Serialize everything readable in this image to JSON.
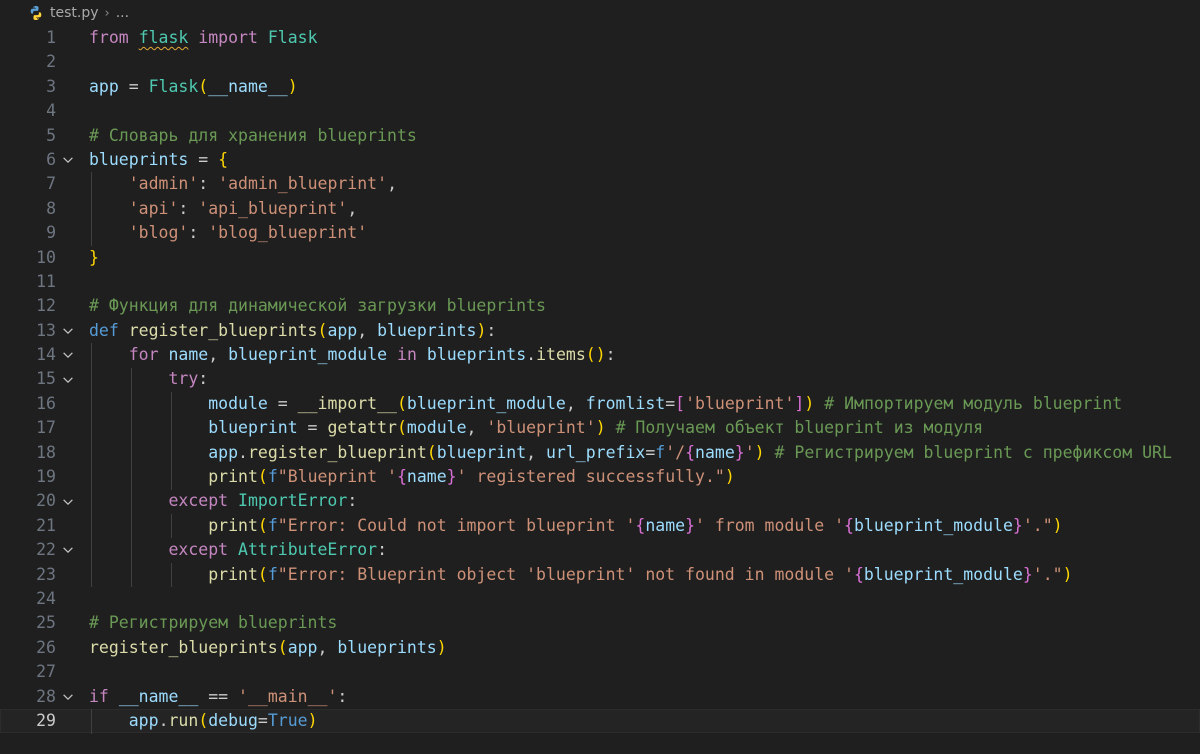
{
  "breadcrumb": {
    "file": "test.py",
    "ellipsis": "..."
  },
  "current_line": 29,
  "lines": [
    {
      "n": "1",
      "fold": false,
      "tokens": [
        {
          "t": "from",
          "c": "ck"
        },
        {
          "t": " "
        },
        {
          "t": "flask",
          "c": "cls squig"
        },
        {
          "t": " "
        },
        {
          "t": "import",
          "c": "ck"
        },
        {
          "t": " "
        },
        {
          "t": "Flask",
          "c": "cls"
        }
      ]
    },
    {
      "n": "2",
      "fold": false,
      "tokens": []
    },
    {
      "n": "3",
      "fold": false,
      "tokens": [
        {
          "t": "app",
          "c": "var"
        },
        {
          "t": " = "
        },
        {
          "t": "Flask",
          "c": "cls"
        },
        {
          "t": "(",
          "c": "b1"
        },
        {
          "t": "__name__",
          "c": "var"
        },
        {
          "t": ")",
          "c": "b1"
        }
      ]
    },
    {
      "n": "4",
      "fold": false,
      "tokens": []
    },
    {
      "n": "5",
      "fold": false,
      "tokens": [
        {
          "t": "# Словарь для хранения blueprints",
          "c": "com"
        }
      ]
    },
    {
      "n": "6",
      "fold": true,
      "tokens": [
        {
          "t": "blueprints",
          "c": "var"
        },
        {
          "t": " = "
        },
        {
          "t": "{",
          "c": "b1"
        }
      ]
    },
    {
      "n": "7",
      "fold": false,
      "tokens": [
        {
          "t": "    "
        },
        {
          "t": "'admin'",
          "c": "str"
        },
        {
          "t": ": "
        },
        {
          "t": "'admin_blueprint'",
          "c": "str"
        },
        {
          "t": ","
        }
      ]
    },
    {
      "n": "8",
      "fold": false,
      "tokens": [
        {
          "t": "    "
        },
        {
          "t": "'api'",
          "c": "str"
        },
        {
          "t": ": "
        },
        {
          "t": "'api_blueprint'",
          "c": "str"
        },
        {
          "t": ","
        }
      ]
    },
    {
      "n": "9",
      "fold": false,
      "tokens": [
        {
          "t": "    "
        },
        {
          "t": "'blog'",
          "c": "str"
        },
        {
          "t": ": "
        },
        {
          "t": "'blog_blueprint'",
          "c": "str"
        }
      ]
    },
    {
      "n": "10",
      "fold": false,
      "tokens": [
        {
          "t": "}",
          "c": "b1"
        }
      ]
    },
    {
      "n": "11",
      "fold": false,
      "tokens": []
    },
    {
      "n": "12",
      "fold": false,
      "tokens": [
        {
          "t": "# Функция для динамической загрузки blueprints",
          "c": "com"
        }
      ]
    },
    {
      "n": "13",
      "fold": true,
      "tokens": [
        {
          "t": "def",
          "c": "kw"
        },
        {
          "t": " "
        },
        {
          "t": "register_blueprints",
          "c": "fn"
        },
        {
          "t": "(",
          "c": "b1"
        },
        {
          "t": "app",
          "c": "var"
        },
        {
          "t": ", "
        },
        {
          "t": "blueprints",
          "c": "var"
        },
        {
          "t": ")",
          "c": "b1"
        },
        {
          "t": ":"
        }
      ]
    },
    {
      "n": "14",
      "fold": true,
      "tokens": [
        {
          "t": "    "
        },
        {
          "t": "for",
          "c": "ck"
        },
        {
          "t": " "
        },
        {
          "t": "name",
          "c": "var"
        },
        {
          "t": ", "
        },
        {
          "t": "blueprint_module",
          "c": "var"
        },
        {
          "t": " "
        },
        {
          "t": "in",
          "c": "ck"
        },
        {
          "t": " "
        },
        {
          "t": "blueprints",
          "c": "var"
        },
        {
          "t": "."
        },
        {
          "t": "items",
          "c": "fn"
        },
        {
          "t": "()",
          "c": "b1"
        },
        {
          "t": ":"
        }
      ]
    },
    {
      "n": "15",
      "fold": true,
      "tokens": [
        {
          "t": "        "
        },
        {
          "t": "try",
          "c": "ck"
        },
        {
          "t": ":"
        }
      ]
    },
    {
      "n": "16",
      "fold": false,
      "tokens": [
        {
          "t": "            "
        },
        {
          "t": "module",
          "c": "var"
        },
        {
          "t": " = "
        },
        {
          "t": "__import__",
          "c": "fn"
        },
        {
          "t": "(",
          "c": "b1"
        },
        {
          "t": "blueprint_module",
          "c": "var"
        },
        {
          "t": ", "
        },
        {
          "t": "fromlist",
          "c": "var"
        },
        {
          "t": "="
        },
        {
          "t": "[",
          "c": "b2"
        },
        {
          "t": "'blueprint'",
          "c": "str"
        },
        {
          "t": "]",
          "c": "b2"
        },
        {
          "t": ")",
          "c": "b1"
        },
        {
          "t": " "
        },
        {
          "t": "# Импортируем модуль blueprint",
          "c": "com"
        }
      ]
    },
    {
      "n": "17",
      "fold": false,
      "tokens": [
        {
          "t": "            "
        },
        {
          "t": "blueprint",
          "c": "var"
        },
        {
          "t": " = "
        },
        {
          "t": "getattr",
          "c": "fn"
        },
        {
          "t": "(",
          "c": "b1"
        },
        {
          "t": "module",
          "c": "var"
        },
        {
          "t": ", "
        },
        {
          "t": "'blueprint'",
          "c": "str"
        },
        {
          "t": ")",
          "c": "b1"
        },
        {
          "t": " "
        },
        {
          "t": "# Получаем объект blueprint из модуля",
          "c": "com"
        }
      ]
    },
    {
      "n": "18",
      "fold": false,
      "tokens": [
        {
          "t": "            "
        },
        {
          "t": "app",
          "c": "var"
        },
        {
          "t": "."
        },
        {
          "t": "register_blueprint",
          "c": "fn"
        },
        {
          "t": "(",
          "c": "b1"
        },
        {
          "t": "blueprint",
          "c": "var"
        },
        {
          "t": ", "
        },
        {
          "t": "url_prefix",
          "c": "var"
        },
        {
          "t": "="
        },
        {
          "t": "f",
          "c": "kw"
        },
        {
          "t": "'/",
          "c": "str"
        },
        {
          "t": "{",
          "c": "b2"
        },
        {
          "t": "name",
          "c": "var"
        },
        {
          "t": "}",
          "c": "b2"
        },
        {
          "t": "'",
          "c": "str"
        },
        {
          "t": ")",
          "c": "b1"
        },
        {
          "t": " "
        },
        {
          "t": "# Регистрируем blueprint с префиксом URL",
          "c": "com"
        }
      ]
    },
    {
      "n": "19",
      "fold": false,
      "tokens": [
        {
          "t": "            "
        },
        {
          "t": "print",
          "c": "fn"
        },
        {
          "t": "(",
          "c": "b1"
        },
        {
          "t": "f",
          "c": "kw"
        },
        {
          "t": "\"Blueprint '",
          "c": "str"
        },
        {
          "t": "{",
          "c": "b2"
        },
        {
          "t": "name",
          "c": "var"
        },
        {
          "t": "}",
          "c": "b2"
        },
        {
          "t": "' registered successfully.\"",
          "c": "str"
        },
        {
          "t": ")",
          "c": "b1"
        }
      ]
    },
    {
      "n": "20",
      "fold": true,
      "tokens": [
        {
          "t": "        "
        },
        {
          "t": "except",
          "c": "ck"
        },
        {
          "t": " "
        },
        {
          "t": "ImportError",
          "c": "cls"
        },
        {
          "t": ":"
        }
      ]
    },
    {
      "n": "21",
      "fold": false,
      "tokens": [
        {
          "t": "            "
        },
        {
          "t": "print",
          "c": "fn"
        },
        {
          "t": "(",
          "c": "b1"
        },
        {
          "t": "f",
          "c": "kw"
        },
        {
          "t": "\"Error: Could not import blueprint '",
          "c": "str"
        },
        {
          "t": "{",
          "c": "b2"
        },
        {
          "t": "name",
          "c": "var"
        },
        {
          "t": "}",
          "c": "b2"
        },
        {
          "t": "' from module '",
          "c": "str"
        },
        {
          "t": "{",
          "c": "b2"
        },
        {
          "t": "blueprint_module",
          "c": "var"
        },
        {
          "t": "}",
          "c": "b2"
        },
        {
          "t": "'.\"",
          "c": "str"
        },
        {
          "t": ")",
          "c": "b1"
        }
      ]
    },
    {
      "n": "22",
      "fold": true,
      "tokens": [
        {
          "t": "        "
        },
        {
          "t": "except",
          "c": "ck"
        },
        {
          "t": " "
        },
        {
          "t": "AttributeError",
          "c": "cls"
        },
        {
          "t": ":"
        }
      ]
    },
    {
      "n": "23",
      "fold": false,
      "tokens": [
        {
          "t": "            "
        },
        {
          "t": "print",
          "c": "fn"
        },
        {
          "t": "(",
          "c": "b1"
        },
        {
          "t": "f",
          "c": "kw"
        },
        {
          "t": "\"Error: Blueprint object 'blueprint' not found in module '",
          "c": "str"
        },
        {
          "t": "{",
          "c": "b2"
        },
        {
          "t": "blueprint_module",
          "c": "var"
        },
        {
          "t": "}",
          "c": "b2"
        },
        {
          "t": "'.\"",
          "c": "str"
        },
        {
          "t": ")",
          "c": "b1"
        }
      ]
    },
    {
      "n": "24",
      "fold": false,
      "tokens": []
    },
    {
      "n": "25",
      "fold": false,
      "tokens": [
        {
          "t": "# Регистрируем blueprints",
          "c": "com"
        }
      ]
    },
    {
      "n": "26",
      "fold": false,
      "tokens": [
        {
          "t": "register_blueprints",
          "c": "fn"
        },
        {
          "t": "(",
          "c": "b1"
        },
        {
          "t": "app",
          "c": "var"
        },
        {
          "t": ", "
        },
        {
          "t": "blueprints",
          "c": "var"
        },
        {
          "t": ")",
          "c": "b1"
        }
      ]
    },
    {
      "n": "27",
      "fold": false,
      "tokens": []
    },
    {
      "n": "28",
      "fold": true,
      "tokens": [
        {
          "t": "if",
          "c": "ck"
        },
        {
          "t": " "
        },
        {
          "t": "__name__",
          "c": "var"
        },
        {
          "t": " == "
        },
        {
          "t": "'__main__'",
          "c": "str"
        },
        {
          "t": ":"
        }
      ]
    },
    {
      "n": "29",
      "fold": false,
      "tokens": [
        {
          "t": "    "
        },
        {
          "t": "app",
          "c": "var"
        },
        {
          "t": "."
        },
        {
          "t": "run",
          "c": "fn"
        },
        {
          "t": "(",
          "c": "b1"
        },
        {
          "t": "debug",
          "c": "var"
        },
        {
          "t": "="
        },
        {
          "t": "True",
          "c": "kw"
        },
        {
          "t": ")",
          "c": "b1"
        }
      ]
    }
  ],
  "colors": {
    "background": "#1f1f1f",
    "keyword": "#569cd6",
    "control": "#c586c0",
    "function": "#dcdcaa",
    "variable": "#9cdcfe",
    "class": "#4ec9b0",
    "string": "#ce9178",
    "comment": "#6a9955",
    "bracket1": "#ffd700",
    "bracket2": "#da70d6"
  }
}
